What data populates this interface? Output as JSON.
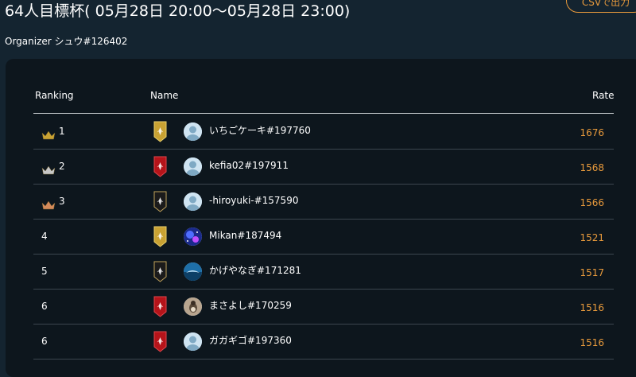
{
  "header": {
    "title": "64人目標杯( 05月28日 20:00～05月28日 23:00)",
    "csv_button": "CSVで出力",
    "organizer": "Organizer シュウ#126402"
  },
  "table": {
    "columns": {
      "ranking": "Ranking",
      "name": "Name",
      "rate": "Rate"
    },
    "rows": [
      {
        "rank": "1",
        "crown": "gold-crown-icon",
        "badge": "gold",
        "avatar": "default-avatar",
        "name": "いちごケーキ#197760",
        "rate": "1676"
      },
      {
        "rank": "2",
        "crown": "silver-crown-icon",
        "badge": "red",
        "avatar": "default-avatar",
        "name": "kefia02#197911",
        "rate": "1568"
      },
      {
        "rank": "3",
        "crown": "bronze-crown-icon",
        "badge": "black",
        "avatar": "default-avatar",
        "name": "-hiroyuki-#157590",
        "rate": "1566"
      },
      {
        "rank": "4",
        "crown": "",
        "badge": "gold",
        "avatar": "galaxy-avatar",
        "name": "Mikan#187494",
        "rate": "1521"
      },
      {
        "rank": "5",
        "crown": "",
        "badge": "black",
        "avatar": "ocean-avatar",
        "name": "かげやなぎ#171281",
        "rate": "1517"
      },
      {
        "rank": "6",
        "crown": "",
        "badge": "red",
        "avatar": "bird-avatar",
        "name": "まさよし#170259",
        "rate": "1516"
      },
      {
        "rank": "6",
        "crown": "",
        "badge": "red",
        "avatar": "default-avatar",
        "name": "ガガギゴ#197360",
        "rate": "1516"
      }
    ]
  },
  "colors": {
    "background": "#142430",
    "panel": "#0d161d",
    "accent": "#e89a3c",
    "gold": "#c9a233",
    "silver": "#c7c7c7",
    "bronze": "#d48a5a",
    "badge_red": "#b5141a",
    "badge_black": "#1b1b1b"
  }
}
